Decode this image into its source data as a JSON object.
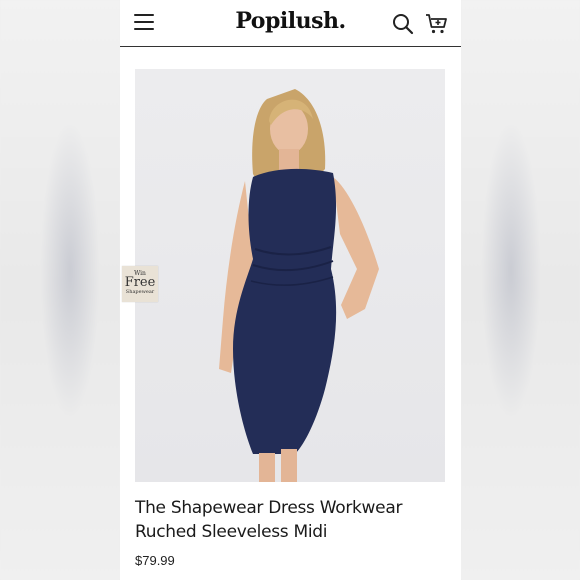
{
  "header": {
    "logo": "Popilush.",
    "icons": {
      "menu": "hamburger-menu-icon",
      "search": "search-icon",
      "cart": "shopping-cart-icon"
    }
  },
  "promo_badge": {
    "line1": "Win",
    "line2": "Free",
    "line3": "Shapewear"
  },
  "product": {
    "image_alt": "Model wearing navy sleeveless midi dress",
    "title_line1": "The Shapewear Dress Workwear",
    "title_line2": "Ruched Sleeveless Midi",
    "price": "$79.99",
    "dress_color": "#232d57"
  }
}
